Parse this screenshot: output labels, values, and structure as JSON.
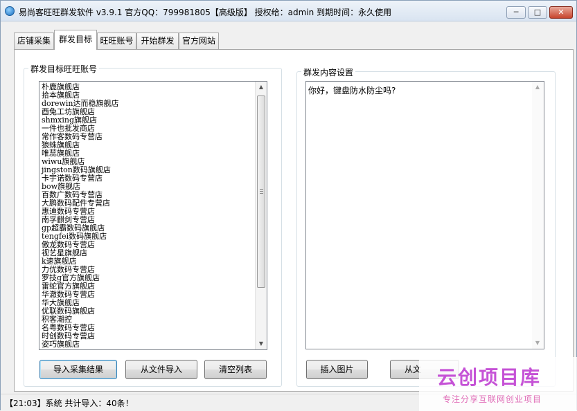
{
  "window": {
    "title": "易尚客旺旺群发软件 v3.9.1 官方QQ：799981805【高级版】 授权给：admin  到期时间：永久使用",
    "minimize_glyph": "─",
    "maximize_glyph": "□",
    "close_glyph": "✕"
  },
  "tabs": [
    {
      "label": "店铺采集"
    },
    {
      "label": "群发目标"
    },
    {
      "label": "旺旺账号"
    },
    {
      "label": "开始群发"
    },
    {
      "label": "官方网站"
    }
  ],
  "active_tab": "群发目标",
  "target_group": {
    "title": "群发目标旺旺账号",
    "accounts": [
      "朴鹿旗舰店",
      "拾本旗舰店",
      "dorewin达而稳旗舰店",
      "酉兔工坊旗舰店",
      "shmxing旗舰店",
      "一件也批发商店",
      "常作客数码专营店",
      "狼蛛旗舰店",
      "唯蕊旗舰店",
      "wiwu旗舰店",
      "jingston数码旗舰店",
      "卡宇诺数码专营店",
      "bow旗舰店",
      "百数广数码专营店",
      "大鹏数码配件专营店",
      "惠迪数码专营店",
      "南孚麒剑专营店",
      "gp超霸数码旗舰店",
      "tengfei数码旗舰店",
      "傲龙数码专营店",
      "视艺星旗舰店",
      "k速旗舰店",
      "力优数码专营店",
      "罗技g官方旗舰店",
      "雷蛇官方旗舰店",
      "华澈数码专营店",
      "华大旗舰店",
      "优联数码旗舰店",
      "积客潮控",
      "名粤数码专营店",
      "时创数码专营店",
      "姿巧旗舰店"
    ],
    "buttons": {
      "import_results": "导入采集结果",
      "import_file": "从文件导入",
      "clear_list": "清空列表"
    }
  },
  "content_group": {
    "title": "群发内容设置",
    "message": "你好，键盘防水防尘吗?",
    "buttons": {
      "insert_image": "插入图片",
      "import_file_partial": "从文"
    }
  },
  "status": {
    "text": "【21:03】系统 共计导入：40条！"
  },
  "watermark": {
    "main": "云创项目库",
    "sub": "专注分享互联网创业项目"
  },
  "colors": {
    "accent": "#3c7fb1",
    "watermark_main": "#c552d6",
    "watermark_sub": "#e06eb8"
  }
}
